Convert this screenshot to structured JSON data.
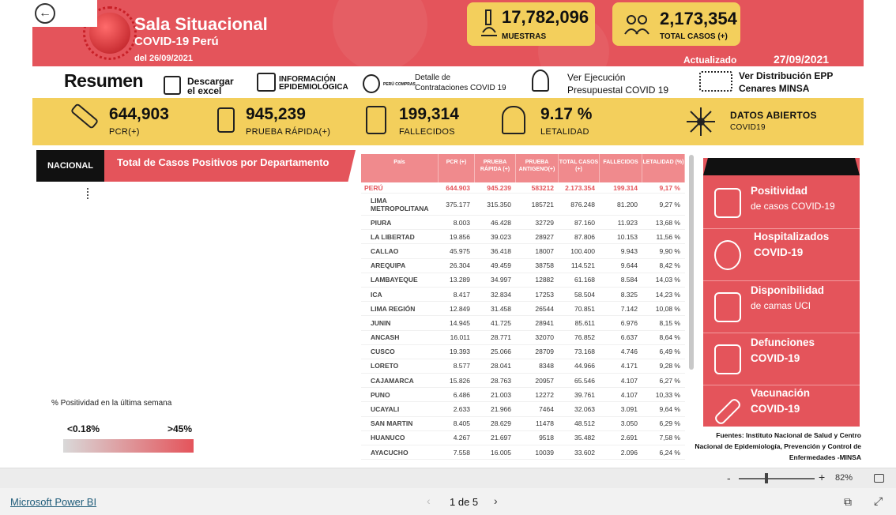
{
  "header": {
    "title": "Sala Situacional",
    "subtitle": "COVID-19 Perú",
    "date_range": "del 26/09/2021",
    "updated_label": "Actualizado",
    "updated_date": "27/09/2021",
    "kpi_muestras": {
      "value": "17,782,096",
      "label": "MUESTRAS"
    },
    "kpi_total": {
      "value": "2,173,354",
      "label": "TOTAL CASOS (+)"
    }
  },
  "row2": {
    "resumen": "Resumen",
    "excel_line1": "Descargar",
    "excel_line2": "el excel",
    "info_line1": "INFORMACIÓN",
    "info_line2": "EPIDEMIOLÓGICA",
    "peru_compras": "PERÚ COMPRAS",
    "contrat_line1": "Detalle de",
    "contrat_line2": "Contrataciones COVID 19",
    "ejec_line1": "Ver Ejecución",
    "ejec_line2": "Presupuestal COVID 19",
    "epp_line1": "Ver Distribución EPP",
    "epp_line2": "Cenares MINSA"
  },
  "row3": {
    "pcr": {
      "value": "644,903",
      "label": "PCR(+)"
    },
    "rapida": {
      "value": "945,239",
      "label": "PRUEBA RÁPIDA(+)"
    },
    "fallecidos": {
      "value": "199,314",
      "label": "FALLECIDOS"
    },
    "letalidad": {
      "value": "9.17 %",
      "label": "LETALIDAD"
    },
    "datos_line1": "DATOS ABIERTOS",
    "datos_line2": "COVID19"
  },
  "map": {
    "tab": "NACIONAL",
    "title": "Total de Casos Positivos por Departamento",
    "note": "% Positividad en la última semana",
    "legend_low": "<0.18%",
    "legend_high": ">45%"
  },
  "table": {
    "headers": [
      "País",
      "PCR (+)",
      "PRUEBA RÁPIDA (+)",
      "PRUEBA ANTIGENO(+)",
      "TOTAL CASOS (+)",
      "FALLECIDOS",
      "LETALIDAD (%)"
    ],
    "rows": [
      [
        "PERÚ",
        "644.903",
        "945.239",
        "583212",
        "2.173.354",
        "199.314",
        "9,17 %"
      ],
      [
        "LIMA METROPOLITANA",
        "375.177",
        "315.350",
        "185721",
        "876.248",
        "81.200",
        "9,27 %"
      ],
      [
        "PIURA",
        "8.003",
        "46.428",
        "32729",
        "87.160",
        "11.923",
        "13,68 %"
      ],
      [
        "LA LIBERTAD",
        "19.856",
        "39.023",
        "28927",
        "87.806",
        "10.153",
        "11,56 %"
      ],
      [
        "CALLAO",
        "45.975",
        "36.418",
        "18007",
        "100.400",
        "9.943",
        "9,90 %"
      ],
      [
        "AREQUIPA",
        "26.304",
        "49.459",
        "38758",
        "114.521",
        "9.644",
        "8,42 %"
      ],
      [
        "LAMBAYEQUE",
        "13.289",
        "34.997",
        "12882",
        "61.168",
        "8.584",
        "14,03 %"
      ],
      [
        "ICA",
        "8.417",
        "32.834",
        "17253",
        "58.504",
        "8.325",
        "14,23 %"
      ],
      [
        "LIMA REGIÓN",
        "12.849",
        "31.458",
        "26544",
        "70.851",
        "7.142",
        "10,08 %"
      ],
      [
        "JUNIN",
        "14.945",
        "41.725",
        "28941",
        "85.611",
        "6.976",
        "8,15 %"
      ],
      [
        "ANCASH",
        "16.011",
        "28.771",
        "32070",
        "76.852",
        "6.637",
        "8,64 %"
      ],
      [
        "CUSCO",
        "19.393",
        "25.066",
        "28709",
        "73.168",
        "4.746",
        "6,49 %"
      ],
      [
        "LORETO",
        "8.577",
        "28.041",
        "8348",
        "44.966",
        "4.171",
        "9,28 %"
      ],
      [
        "CAJAMARCA",
        "15.826",
        "28.763",
        "20957",
        "65.546",
        "4.107",
        "6,27 %"
      ],
      [
        "PUNO",
        "6.486",
        "21.003",
        "12272",
        "39.761",
        "4.107",
        "10,33 %"
      ],
      [
        "UCAYALI",
        "2.633",
        "21.966",
        "7464",
        "32.063",
        "3.091",
        "9,64 %"
      ],
      [
        "SAN MARTIN",
        "8.405",
        "28.629",
        "11478",
        "48.512",
        "3.050",
        "6,29 %"
      ],
      [
        "HUANUCO",
        "4.267",
        "21.697",
        "9518",
        "35.482",
        "2.691",
        "7,58 %"
      ],
      [
        "AYACUCHO",
        "7.558",
        "16.005",
        "10039",
        "33.602",
        "2.096",
        "6,24 %"
      ]
    ]
  },
  "panel": {
    "positividad": {
      "t1": "Positividad",
      "t2": "de casos COVID-19"
    },
    "hospitalizados": {
      "t1": "Hospitalizados",
      "t2": "COVID-19"
    },
    "disponibilidad": {
      "t1": "Disponibilidad",
      "t2": "de camas UCI"
    },
    "defunciones": {
      "t1": "Defunciones",
      "t2": "COVID-19"
    },
    "vacunacion": {
      "t1": "Vacunación",
      "t2": "COVID-19"
    }
  },
  "sources": {
    "line1": "Fuentes: Instituto Nacional de Salud y Centro",
    "line2": "Nacional de Epidemiología, Prevención y Control de",
    "line3": "Enfermedades -MINSA"
  },
  "zoom": {
    "minus": "-",
    "plus": "+",
    "value": "82%"
  },
  "footer": {
    "brand": "Microsoft Power BI",
    "page": "1 de 5",
    "prev": "‹",
    "next": "›"
  },
  "colors": {
    "accent": "#e4545b",
    "yellow": "#f3cf5c"
  }
}
